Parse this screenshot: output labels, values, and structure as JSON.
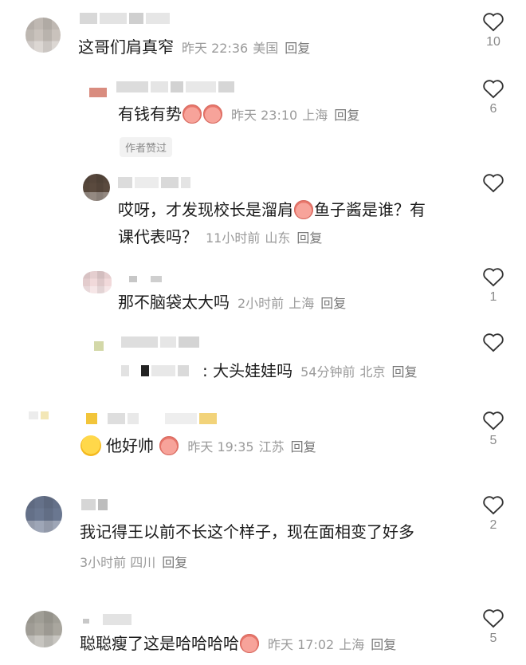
{
  "comments": [
    {
      "text": "这哥们肩真窄",
      "time": "昨天 22:36",
      "location": "美国",
      "reply": "回复",
      "likes": "10"
    },
    {
      "text": "有钱有势",
      "time": "昨天 23:10",
      "location": "上海",
      "reply": "回复",
      "likes": "6",
      "badge": "作者赞过"
    },
    {
      "text_line1": "哎呀，才发现校长是溜肩",
      "text_line1b": "鱼子酱是谁？有",
      "text_line2": "课代表吗？",
      "time": "11小时前",
      "location": "山东",
      "reply": "回复",
      "likes": ""
    },
    {
      "text": "那不脑袋太大吗",
      "time": "2小时前",
      "location": "上海",
      "reply": "回复",
      "likes": "1"
    },
    {
      "text": ": 大头娃娃吗",
      "time": "54分钟前",
      "location": "北京",
      "reply": "回复",
      "likes": ""
    },
    {
      "text": "他好帅",
      "time": "昨天 19:35",
      "location": "江苏",
      "reply": "回复",
      "likes": "5"
    },
    {
      "text": "我记得王以前不长这个样子，现在面相变了好多",
      "time": "3小时前",
      "location": "四川",
      "reply": "回复",
      "likes": "2"
    },
    {
      "text": "聪聪瘦了这是哈哈哈哈",
      "time": "昨天 17:02",
      "location": "上海",
      "reply": "回复",
      "likes": "5"
    }
  ],
  "icons": {
    "like": "heart-outline-icon",
    "emoji_pig": "pig-face-emoji",
    "emoji_laugh": "tears-of-joy-emoji"
  },
  "colors": {
    "meta": "#9a9a9a",
    "text": "#1b1b1b",
    "heart": "#333333"
  }
}
